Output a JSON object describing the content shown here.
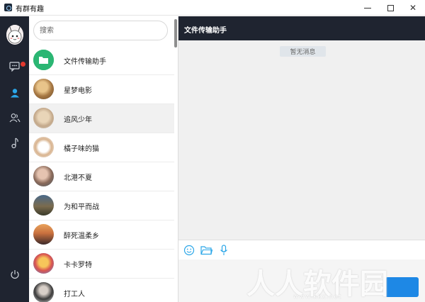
{
  "app": {
    "title": "有群有趣"
  },
  "window_controls": {
    "min_icon": "minimize-icon",
    "max_icon": "maximize-icon",
    "close_label": "✕"
  },
  "sidebar": {
    "icons": [
      "profile-avatar",
      "chat-icon",
      "contact-icon",
      "group-icon",
      "music-icon",
      "power-icon"
    ],
    "unread_dot_color": "#e2392f",
    "accent_color": "#2aa6e8"
  },
  "search": {
    "placeholder": "搜索",
    "value": ""
  },
  "contacts": [
    {
      "name": "文件传输助手",
      "avatar": "file-transfer-icon"
    },
    {
      "name": "星梦电影",
      "avatar": "photo"
    },
    {
      "name": "追风少年",
      "avatar": "photo"
    },
    {
      "name": "橘子味的猫",
      "avatar": "photo"
    },
    {
      "name": "北港不夏",
      "avatar": "photo"
    },
    {
      "name": "为和平而战",
      "avatar": "photo"
    },
    {
      "name": "醉死温柔乡",
      "avatar": "photo"
    },
    {
      "name": "卡卡罗特",
      "avatar": "photo"
    },
    {
      "name": "打工人",
      "avatar": "photo"
    }
  ],
  "chat": {
    "title": "文件传输助手",
    "empty_text": "暂无消息",
    "toolbar": [
      "emoji-icon",
      "folder-icon",
      "microphone-icon"
    ]
  },
  "watermark": {
    "text": "人人软件园",
    "url": "www.kkx.net"
  }
}
